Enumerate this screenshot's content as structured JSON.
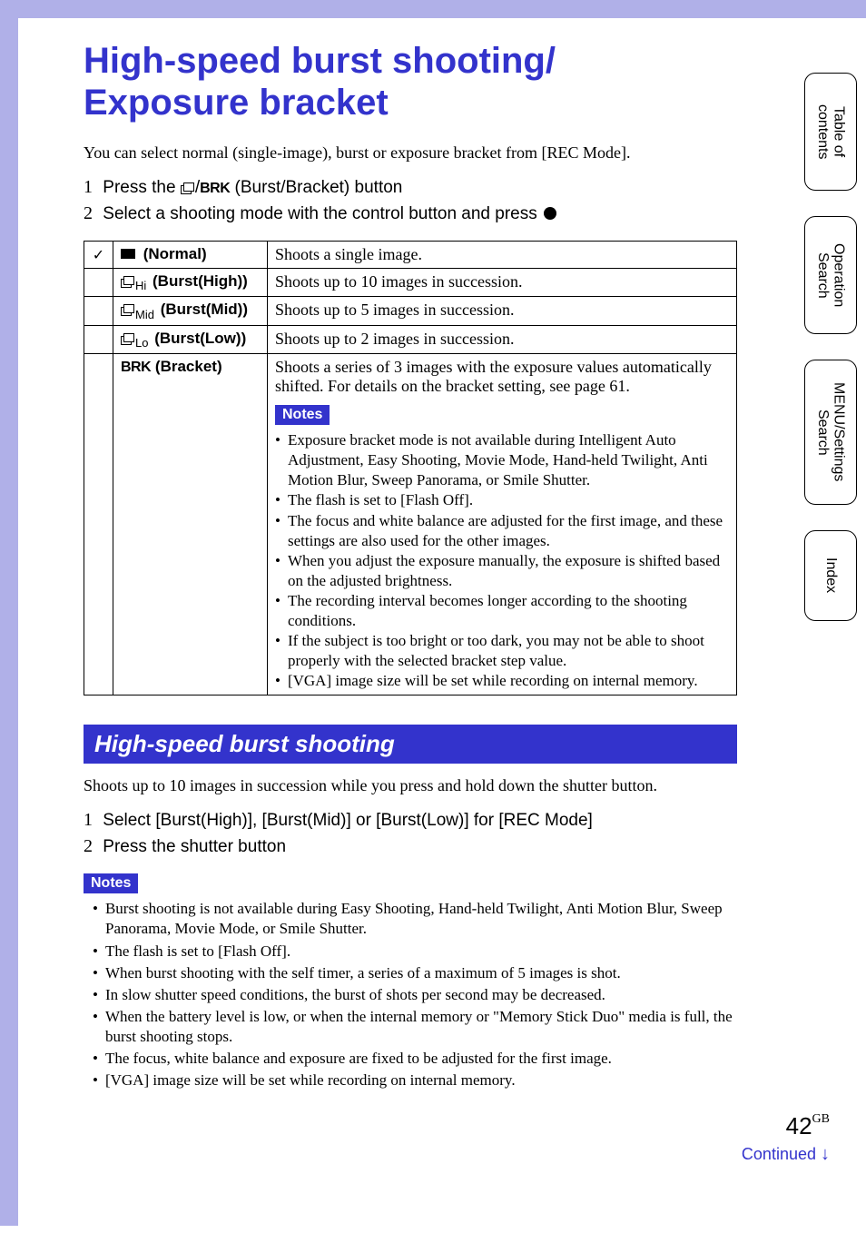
{
  "sideTabs": {
    "toc": "Table of\ncontents",
    "operation": "Operation\nSearch",
    "menu": "MENU/Settings\nSearch",
    "index": "Index"
  },
  "title": "High-speed burst shooting/\nExposure bracket",
  "intro": "You can select normal (single-image), burst or exposure bracket from [REC Mode].",
  "steps": {
    "s1_prefix": "Press the ",
    "s1_brk": "BRK",
    "s1_suffix": " (Burst/Bracket) button",
    "s2": "Select a shooting mode with the control button and press "
  },
  "table": {
    "rows": [
      {
        "label": "(Normal)",
        "desc": "Shoots a single image."
      },
      {
        "label": "(Burst(High))",
        "desc": "Shoots up to 10 images in succession."
      },
      {
        "label": "(Burst(Mid))",
        "desc": "Shoots up to 5 images in succession."
      },
      {
        "label": "(Burst(Low))",
        "desc": "Shoots up to 2 images in succession."
      }
    ],
    "bracket": {
      "label": "(Bracket)",
      "brk": "BRK",
      "desc": "Shoots a series of 3 images with the exposure values automatically shifted. For details on the bracket setting, see page 61.",
      "notesLabel": "Notes",
      "notes": [
        "Exposure bracket mode is not available during Intelligent Auto Adjustment, Easy Shooting, Movie Mode, Hand-held Twilight, Anti Motion Blur, Sweep Panorama, or Smile Shutter.",
        "The flash is set to [Flash Off].",
        "The focus and white balance are adjusted for the first image, and these settings are also used for the other images.",
        "When you adjust the exposure manually, the exposure is shifted based on the adjusted brightness.",
        "The recording interval becomes longer according to the shooting conditions.",
        "If the subject is too bright or too dark, you may not be able to shoot properly with the selected bracket step value.",
        "[VGA] image size will be set while recording on internal memory."
      ]
    }
  },
  "section": {
    "header": "High-speed burst shooting",
    "intro": "Shoots up to 10 images in succession while you press and hold down the shutter button.",
    "step1": "Select [Burst(High)], [Burst(Mid)] or [Burst(Low)] for [REC Mode]",
    "step2": "Press the shutter button",
    "notesLabel": "Notes",
    "notes": [
      "Burst shooting is not available during Easy Shooting, Hand-held Twilight, Anti Motion Blur, Sweep Panorama, Movie Mode, or Smile Shutter.",
      "The flash is set to [Flash Off].",
      "When burst shooting with the self timer, a series of a maximum of 5 images is shot.",
      "In slow shutter speed conditions, the burst of shots per second may be decreased.",
      "When the battery level is low, or when the internal memory or \"Memory Stick Duo\" media is full, the burst shooting stops.",
      "The focus, white balance and exposure are fixed to be adjusted for the first image.",
      "[VGA] image size will be set while recording on internal memory."
    ]
  },
  "footer": {
    "pageNum": "42",
    "gb": "GB",
    "continued": "Continued ",
    "arrow": "↓"
  }
}
